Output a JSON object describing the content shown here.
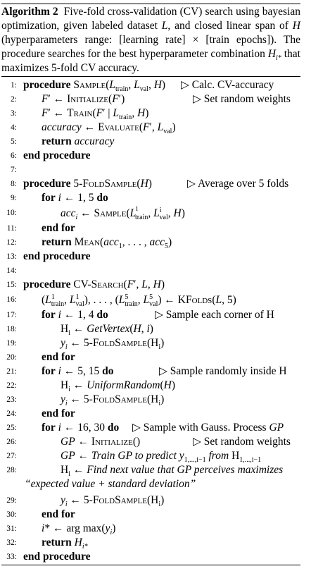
{
  "algorithm": {
    "caption": {
      "label": "Algorithm 2",
      "text": "Five-fold cross-validation (CV) search using bayesian optimization, given labeled dataset L, and closed linear span of H (hyperparameters range: [learning rate] × [train epochs]). The procedure searches for the best hyperparameter combination Hi* that maximizes 5-fold CV accuracy."
    },
    "lines": [
      {
        "n": "1:",
        "text": "procedure Sample(Ltrain, Lval, H)",
        "comment": "▷ Calc. CV-accuracy"
      },
      {
        "n": "2:",
        "text": "F′ ← Initialize(F′)",
        "comment": "▷ Set random weights"
      },
      {
        "n": "3:",
        "text": "F′ ← Train(F′ | Ltrain, H)",
        "comment": ""
      },
      {
        "n": "4:",
        "text": "accuracy ← Evaluate(F′, Lval)",
        "comment": ""
      },
      {
        "n": "5:",
        "text": "return accuracy",
        "comment": ""
      },
      {
        "n": "6:",
        "text": "end procedure",
        "comment": ""
      },
      {
        "n": "7:",
        "text": "",
        "comment": ""
      },
      {
        "n": "8:",
        "text": "procedure 5-FoldSample(H)",
        "comment": "▷ Average over 5 folds"
      },
      {
        "n": "9:",
        "text": "for i ← 1, 5 do",
        "comment": ""
      },
      {
        "n": "10:",
        "text": "acci ← Sample(Litrain, Lival, H)",
        "comment": ""
      },
      {
        "n": "11:",
        "text": "end for",
        "comment": ""
      },
      {
        "n": "12:",
        "text": "return Mean(acc1, . . . , acc5)",
        "comment": ""
      },
      {
        "n": "13:",
        "text": "end procedure",
        "comment": ""
      },
      {
        "n": "14:",
        "text": "",
        "comment": ""
      },
      {
        "n": "15:",
        "text": "procedure CV-Search(F′, L, H)",
        "comment": ""
      },
      {
        "n": "16:",
        "text": "(L1train, L1val), . . . , (L5train, L5val) ← KFolds(L, 5)",
        "comment": ""
      },
      {
        "n": "17:",
        "text": "for i ← 1, 4 do",
        "comment": "▷ Sample each corner of H"
      },
      {
        "n": "18:",
        "text": "Hi ← GetVertex(H, i)",
        "comment": ""
      },
      {
        "n": "19:",
        "text": "yi ← 5-FoldSample(Hi)",
        "comment": ""
      },
      {
        "n": "20:",
        "text": "end for",
        "comment": ""
      },
      {
        "n": "21:",
        "text": "for i ← 5, 15 do",
        "comment": "▷ Sample randomly inside H"
      },
      {
        "n": "22:",
        "text": "Hi ← UniformRandom(H)",
        "comment": ""
      },
      {
        "n": "23:",
        "text": "yi ← 5-FoldSample(Hi)",
        "comment": ""
      },
      {
        "n": "24:",
        "text": "end for",
        "comment": ""
      },
      {
        "n": "25:",
        "text": "for i ← 16, 30 do",
        "comment": "▷ Sample with Gauss. Process GP"
      },
      {
        "n": "26:",
        "text": "GP ← Initialize()",
        "comment": "▷ Set random weights"
      },
      {
        "n": "27:",
        "text": "GP ← Train GP to predict y1,...,i−1 from H1,...,i−1",
        "comment": ""
      },
      {
        "n": "28:",
        "text": "Hi ← Find next value that GP perceives maximizes “expected value + standard deviation”",
        "comment": ""
      },
      {
        "n": "29:",
        "text": "yi ← 5-FoldSample(Hi)",
        "comment": ""
      },
      {
        "n": "30:",
        "text": "end for",
        "comment": ""
      },
      {
        "n": "31:",
        "text": "i* ← arg max(yi)",
        "comment": ""
      },
      {
        "n": "32:",
        "text": "return Hi*",
        "comment": ""
      },
      {
        "n": "33:",
        "text": "end procedure",
        "comment": ""
      }
    ]
  }
}
